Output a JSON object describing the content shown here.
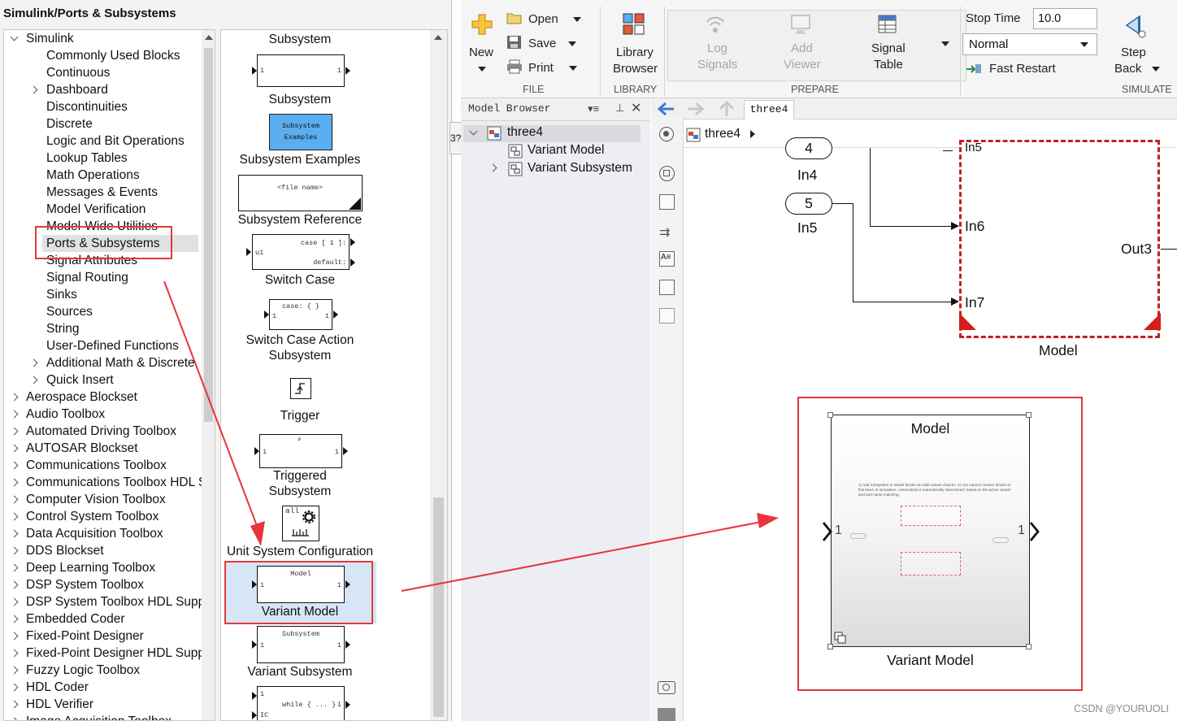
{
  "library": {
    "title": "Simulink/Ports & Subsystems",
    "tree": [
      {
        "label": "Simulink",
        "expanded": true
      },
      {
        "label": "Commonly Used Blocks"
      },
      {
        "label": "Continuous"
      },
      {
        "label": "Dashboard",
        "collapsed": true
      },
      {
        "label": "Discontinuities"
      },
      {
        "label": "Discrete"
      },
      {
        "label": "Logic and Bit Operations"
      },
      {
        "label": "Lookup Tables"
      },
      {
        "label": "Math Operations"
      },
      {
        "label": "Messages & Events"
      },
      {
        "label": "Model Verification"
      },
      {
        "label": "Model-Wide Utilities"
      },
      {
        "label": "Ports & Subsystems",
        "selected": true
      },
      {
        "label": "Signal Attributes"
      },
      {
        "label": "Signal Routing"
      },
      {
        "label": "Sinks"
      },
      {
        "label": "Sources"
      },
      {
        "label": "String"
      },
      {
        "label": "User-Defined Functions"
      },
      {
        "label": "Additional Math & Discrete",
        "collapsed": true
      },
      {
        "label": "Quick Insert",
        "collapsed": true
      },
      {
        "label": "Aerospace Blockset",
        "collapsed": true
      },
      {
        "label": "Audio Toolbox",
        "collapsed": true
      },
      {
        "label": "Automated Driving Toolbox",
        "collapsed": true
      },
      {
        "label": "AUTOSAR Blockset",
        "collapsed": true
      },
      {
        "label": "Communications Toolbox",
        "collapsed": true
      },
      {
        "label": "Communications Toolbox HDL Support",
        "collapsed": true
      },
      {
        "label": "Computer Vision Toolbox",
        "collapsed": true
      },
      {
        "label": "Control System Toolbox",
        "collapsed": true
      },
      {
        "label": "Data Acquisition Toolbox",
        "collapsed": true
      },
      {
        "label": "DDS Blockset",
        "collapsed": true
      },
      {
        "label": "Deep Learning Toolbox",
        "collapsed": true
      },
      {
        "label": "DSP System Toolbox",
        "collapsed": true
      },
      {
        "label": "DSP System Toolbox HDL Support",
        "collapsed": true
      },
      {
        "label": "Embedded Coder",
        "collapsed": true
      },
      {
        "label": "Fixed-Point Designer",
        "collapsed": true
      },
      {
        "label": "Fixed-Point Designer HDL Support",
        "collapsed": true
      },
      {
        "label": "Fuzzy Logic Toolbox",
        "collapsed": true
      },
      {
        "label": "HDL Coder",
        "collapsed": true
      },
      {
        "label": "HDL Verifier",
        "collapsed": true
      },
      {
        "label": "Image Acquisition Toolbox",
        "collapsed": true
      }
    ],
    "blocks": {
      "top_label": "Subsystem",
      "subsystem": "Subsystem",
      "subsystem_examples_icon_line1": "Subsystem",
      "subsystem_examples_icon_line2": "Examples",
      "subsystem_examples": "Subsystem Examples",
      "file_name_tag": "<file name>",
      "subsystem_reference": "Subsystem Reference",
      "switch_case_in": "u1",
      "switch_case_case": "case [ 1 ]:",
      "switch_case_default": "default:",
      "switch_case": "Switch Case",
      "action_case_text": "case: { }",
      "switch_case_action_1": "Switch Case Action",
      "switch_case_action_2": "Subsystem",
      "trigger": "Trigger",
      "triggered_1": "Triggered",
      "triggered_2": "Subsystem",
      "unit_all": "all",
      "unit_system_configuration": "Unit System Configuration",
      "variant_icon_text": "Model",
      "variant_model": "Variant Model",
      "variant_sub_icon_text": "Subsystem",
      "variant_subsystem": "Variant Subsystem",
      "while_text": "while { ... }",
      "port_one": "1",
      "port_ic": "IC"
    }
  },
  "toolstrip": {
    "new": "New",
    "open": "Open",
    "save": "Save",
    "print": "Print",
    "file": "FILE",
    "library_browser_1": "Library",
    "library_browser_2": "Browser",
    "library": "LIBRARY",
    "log_signals_1": "Log",
    "log_signals_2": "Signals",
    "add_viewer_1": "Add",
    "add_viewer_2": "Viewer",
    "signal_table_1": "Signal",
    "signal_table_2": "Table",
    "prepare": "PREPARE",
    "stop_time_label": "Stop Time",
    "stop_time_value": "10.0",
    "sim_mode": "Normal",
    "fast_restart": "Fast Restart",
    "step_back_1": "Step",
    "step_back_2": "Back",
    "simulate": "SIMULATE"
  },
  "model_browser": {
    "title": "Model Browser",
    "root": "three4",
    "children": [
      "Variant Model",
      "Variant Subsystem"
    ],
    "side_tab": "3?"
  },
  "editor": {
    "tab": "three4",
    "breadcrumb": "three4",
    "in4_number": "4",
    "in4": "In4",
    "in5_number": "5",
    "in5": "In5",
    "model_in5": "In5",
    "model_in6": "In6",
    "model_in7": "In7",
    "model_out3": "Out3",
    "model_label": "Model",
    "vm_title": "Model",
    "vm_note": "1) Add Subsystem or Model blocks as valid variant choices. 2) You cannot connect blocks at this level. At simulation, connectivity is automatically determined, based on the active variant and port name matching.",
    "vm_in": "1",
    "vm_out": "1",
    "vm_label": "Variant Model"
  },
  "watermark": "CSDN @YOURUOLI",
  "colors": {
    "highlight": "#e23a3a",
    "selected_block_bg": "#5aaef0",
    "accent_blue": "#1f66c8"
  }
}
